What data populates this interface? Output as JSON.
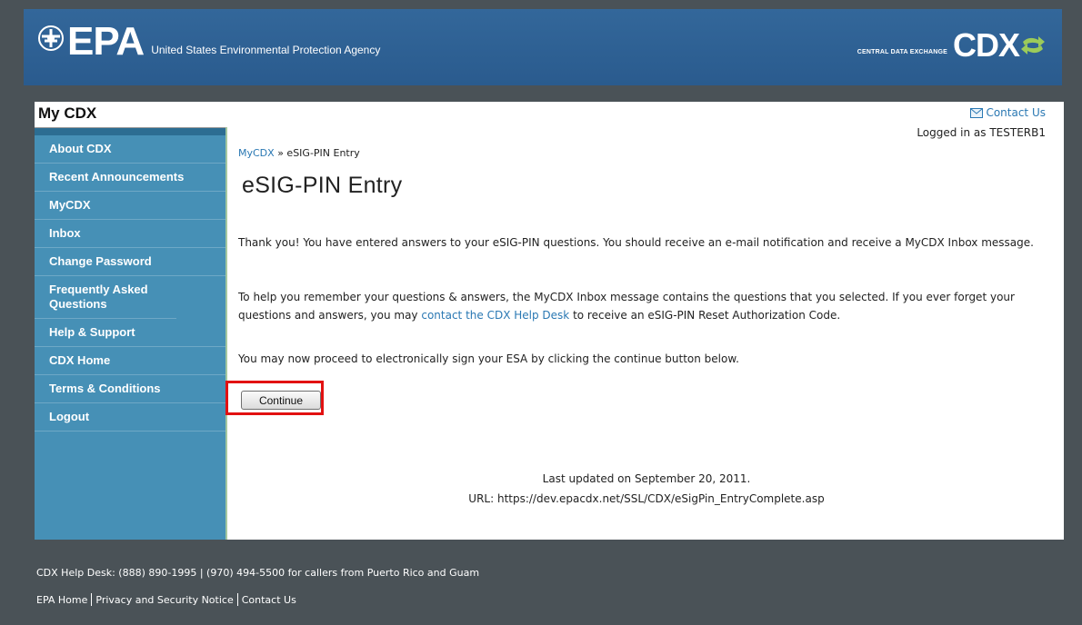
{
  "header": {
    "epa_logo_text": "EPA",
    "agency_name": "United States Environmental Protection Agency",
    "cdx_subtitle": "CENTRAL DATA EXCHANGE",
    "cdx_logo_text": "CDX"
  },
  "sidebar": {
    "title": "My CDX",
    "items": [
      {
        "label": "About CDX"
      },
      {
        "label": "Recent Announcements"
      },
      {
        "label": "MyCDX"
      },
      {
        "label": "Inbox"
      },
      {
        "label": "Change Password"
      },
      {
        "label": "Frequently Asked Questions"
      },
      {
        "label": "Help & Support"
      },
      {
        "label": "CDX Home"
      },
      {
        "label": "Terms & Conditions"
      },
      {
        "label": "Logout"
      }
    ]
  },
  "top_right": {
    "contact_label": "Contact Us",
    "logged_in": "Logged in as TESTERB1"
  },
  "breadcrumb": {
    "link": "MyCDX",
    "separator": "»",
    "current": "eSIG-PIN Entry"
  },
  "page_title": "eSIG-PIN Entry",
  "paragraphs": {
    "p1": "Thank you! You have entered answers to your eSIG-PIN questions. You should receive an e-mail notification and receive a MyCDX Inbox message.",
    "p2_before": "To help you remember your questions & answers, the MyCDX Inbox message contains the questions that you selected. If you ever forget your questions and answers, you may ",
    "p2_link": "contact the CDX Help Desk",
    "p2_after": " to receive an eSIG-PIN Reset Authorization Code.",
    "p3": "You may now proceed to electronically sign your ESA by clicking the continue button below."
  },
  "continue_button": "Continue",
  "page_footer": {
    "updated": "Last updated on September 20, 2011.",
    "url": "URL: https://dev.epacdx.net/SSL/CDX/eSigPin_EntryComplete.asp"
  },
  "site_footer": {
    "helpdesk": "CDX Help Desk: (888) 890-1995 | (970) 494-5500 for callers from Puerto Rico and Guam",
    "links": [
      "EPA Home",
      "Privacy and Security Notice",
      "Contact Us"
    ]
  },
  "colors": {
    "page_bg": "#4a5257",
    "header_bg": "#2f6296",
    "sidebar_bg": "#4690b6",
    "link": "#2a78b3",
    "highlight": "#e21111"
  }
}
